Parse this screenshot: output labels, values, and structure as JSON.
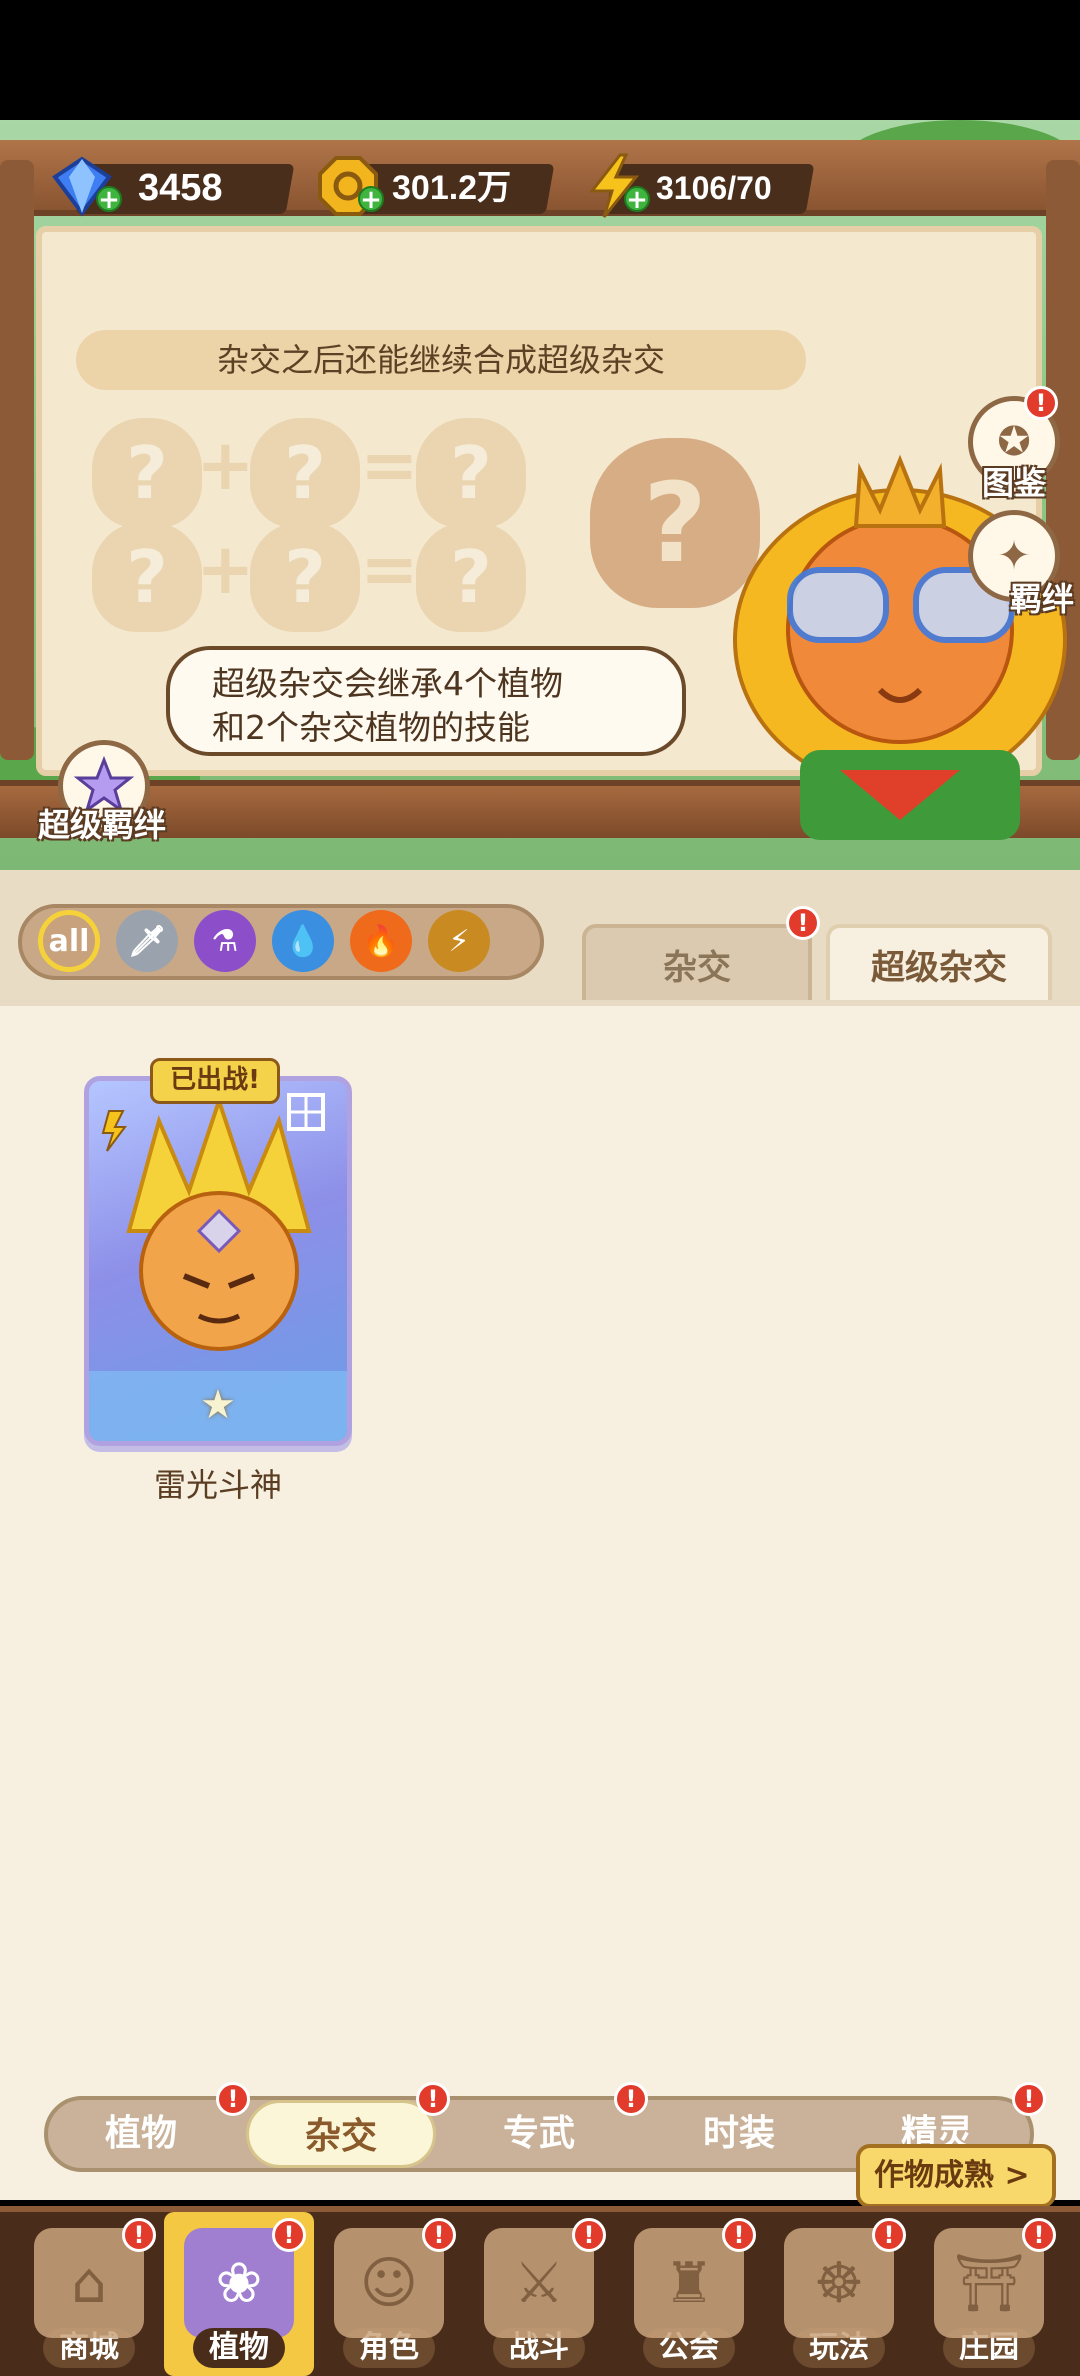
{
  "currency": {
    "gems": "3458",
    "coins": "301.2万",
    "energy": "3106/70"
  },
  "banner": {
    "tip": "杂交之后还能继续合成超级杂交",
    "bubble_line1": "超级杂交会继承4个植物",
    "bubble_line2": "和2个杂交植物的技能",
    "left_button_label": "超级羁绊",
    "side_buttons": [
      {
        "label": "图鉴",
        "icon": "book-icon"
      },
      {
        "label": "羁绊",
        "icon": "bond-star-icon"
      }
    ]
  },
  "filters": [
    {
      "label": "all",
      "icon": "all-filter-icon",
      "color": "#c7a27c"
    },
    {
      "label": "",
      "icon": "sword-icon",
      "color": "#9aa3ad"
    },
    {
      "label": "",
      "icon": "potion-icon",
      "color": "#8d4fc9"
    },
    {
      "label": "",
      "icon": "water-drop-icon",
      "color": "#3b8fe0"
    },
    {
      "label": "",
      "icon": "fire-icon",
      "color": "#ef6a1a"
    },
    {
      "label": "",
      "icon": "lightning-icon",
      "color": "#c98a22"
    }
  ],
  "tabs": [
    {
      "label": "杂交"
    },
    {
      "label": "超级杂交"
    }
  ],
  "card": {
    "tag": "已出战!",
    "name": "雷光斗神",
    "stars": "★"
  },
  "categories": [
    {
      "label": "植物"
    },
    {
      "label": "杂交"
    },
    {
      "label": "专武"
    },
    {
      "label": "时装"
    },
    {
      "label": "精灵"
    }
  ],
  "ripe_button": "作物成熟 >",
  "nav": [
    {
      "label": "商城"
    },
    {
      "label": "植物"
    },
    {
      "label": "角色"
    },
    {
      "label": "战斗"
    },
    {
      "label": "公会"
    },
    {
      "label": "玩法"
    },
    {
      "label": "庄园"
    }
  ],
  "badge": "!"
}
